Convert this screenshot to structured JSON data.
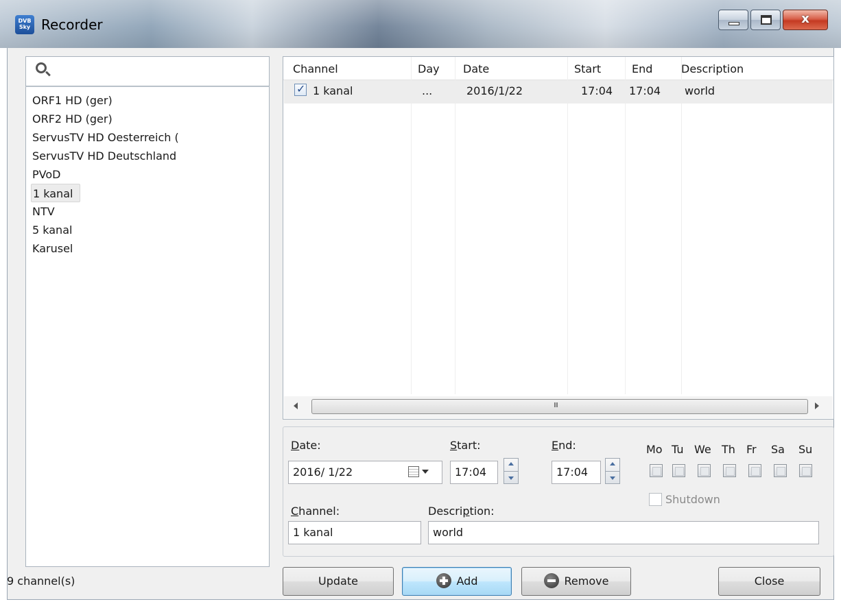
{
  "window": {
    "title": "Recorder",
    "icon": "dvbsky-app-icon",
    "icon_text": "DVB Sky"
  },
  "sidebar": {
    "search_placeholder": "",
    "channels": [
      {
        "label": "ORF1 HD (ger)",
        "selected": false
      },
      {
        "label": "ORF2 HD (ger)",
        "selected": false
      },
      {
        "label": "ServusTV HD Oesterreich (",
        "selected": false
      },
      {
        "label": "ServusTV HD Deutschland",
        "selected": false
      },
      {
        "label": "PVoD",
        "selected": false
      },
      {
        "label": "1 kanal",
        "selected": true
      },
      {
        "label": "NTV",
        "selected": false
      },
      {
        "label": "5 kanal",
        "selected": false
      },
      {
        "label": "Karusel",
        "selected": false
      }
    ],
    "channel_count": "9 channel(s)"
  },
  "recordings": {
    "columns": [
      "Channel",
      "Day",
      "Date",
      "Start",
      "End",
      "Description"
    ],
    "rows": [
      {
        "checked": true,
        "channel": "1 kanal",
        "day": "...",
        "date": "2016/1/22",
        "start": "17:04",
        "end": "17:04",
        "description": "world"
      }
    ],
    "scroll_grip": "III"
  },
  "editor": {
    "date_label_u": "D",
    "date_label_rest": "ate:",
    "date_value": "2016/ 1/22",
    "start_label_u": "S",
    "start_label_rest": "tart:",
    "start_value": "17:04",
    "end_label_u": "E",
    "end_label_rest": "nd:",
    "end_value": "17:04",
    "days": [
      "Mo",
      "Tu",
      "We",
      "Th",
      "Fr",
      "Sa",
      "Su"
    ],
    "shutdown_label": "Shutdown",
    "channel_label_u": "C",
    "channel_label_rest": "hannel:",
    "channel_value": "1 kanal",
    "description_label_a": "Descri",
    "description_label_u": "p",
    "description_label_b": "tion:",
    "description_value": "world"
  },
  "buttons": {
    "update": "Update",
    "add": "Add",
    "remove": "Remove",
    "close": "Close"
  },
  "colors": {
    "selection_row": "#ededed",
    "focused_button": "#bee6fd",
    "close_button": "#c43a22"
  }
}
